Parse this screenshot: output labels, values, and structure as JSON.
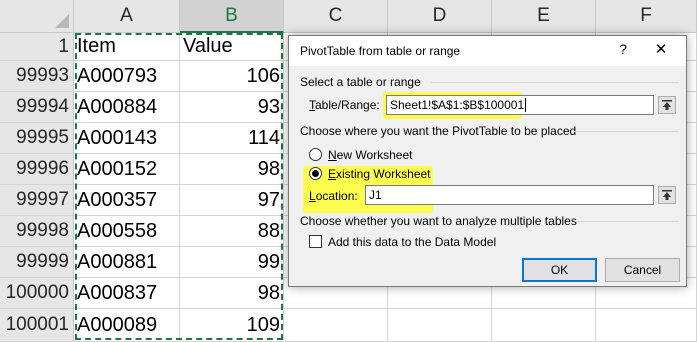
{
  "spreadsheet": {
    "columns": [
      "A",
      "B",
      "C",
      "D",
      "E",
      "F"
    ],
    "rows": [
      {
        "num": "1",
        "item": "Item",
        "value": "Value"
      },
      {
        "num": "99993",
        "item": "A000793",
        "value": "106"
      },
      {
        "num": "99994",
        "item": "A000884",
        "value": "93"
      },
      {
        "num": "99995",
        "item": "A000143",
        "value": "114"
      },
      {
        "num": "99996",
        "item": "A000152",
        "value": "98"
      },
      {
        "num": "99997",
        "item": "A000357",
        "value": "97"
      },
      {
        "num": "99998",
        "item": "A000558",
        "value": "88"
      },
      {
        "num": "99999",
        "item": "A000881",
        "value": "99"
      },
      {
        "num": "100000",
        "item": "A000837",
        "value": "98"
      },
      {
        "num": "100001",
        "item": "A000089",
        "value": "109"
      }
    ]
  },
  "dialog": {
    "title": "PivotTable from table or range",
    "help_label": "?",
    "close_label": "✕",
    "section1": "Select a table or range",
    "table_range_label": "Table/Range:",
    "table_range_value": "Sheet1!$A$1:$B$100001",
    "section2": "Choose where you want the PivotTable to be placed",
    "new_worksheet": "New Worksheet",
    "existing_worksheet": "Existing Worksheet",
    "location_label": "Location:",
    "location_value": "J1",
    "section3": "Choose whether you want to analyze multiple tables",
    "data_model_label": "Add this data to the Data Model",
    "ok_label": "OK",
    "cancel_label": "Cancel"
  },
  "colors": {
    "highlight": "#ffff33",
    "excel_green": "#217346",
    "button_focus": "#0078d7"
  }
}
